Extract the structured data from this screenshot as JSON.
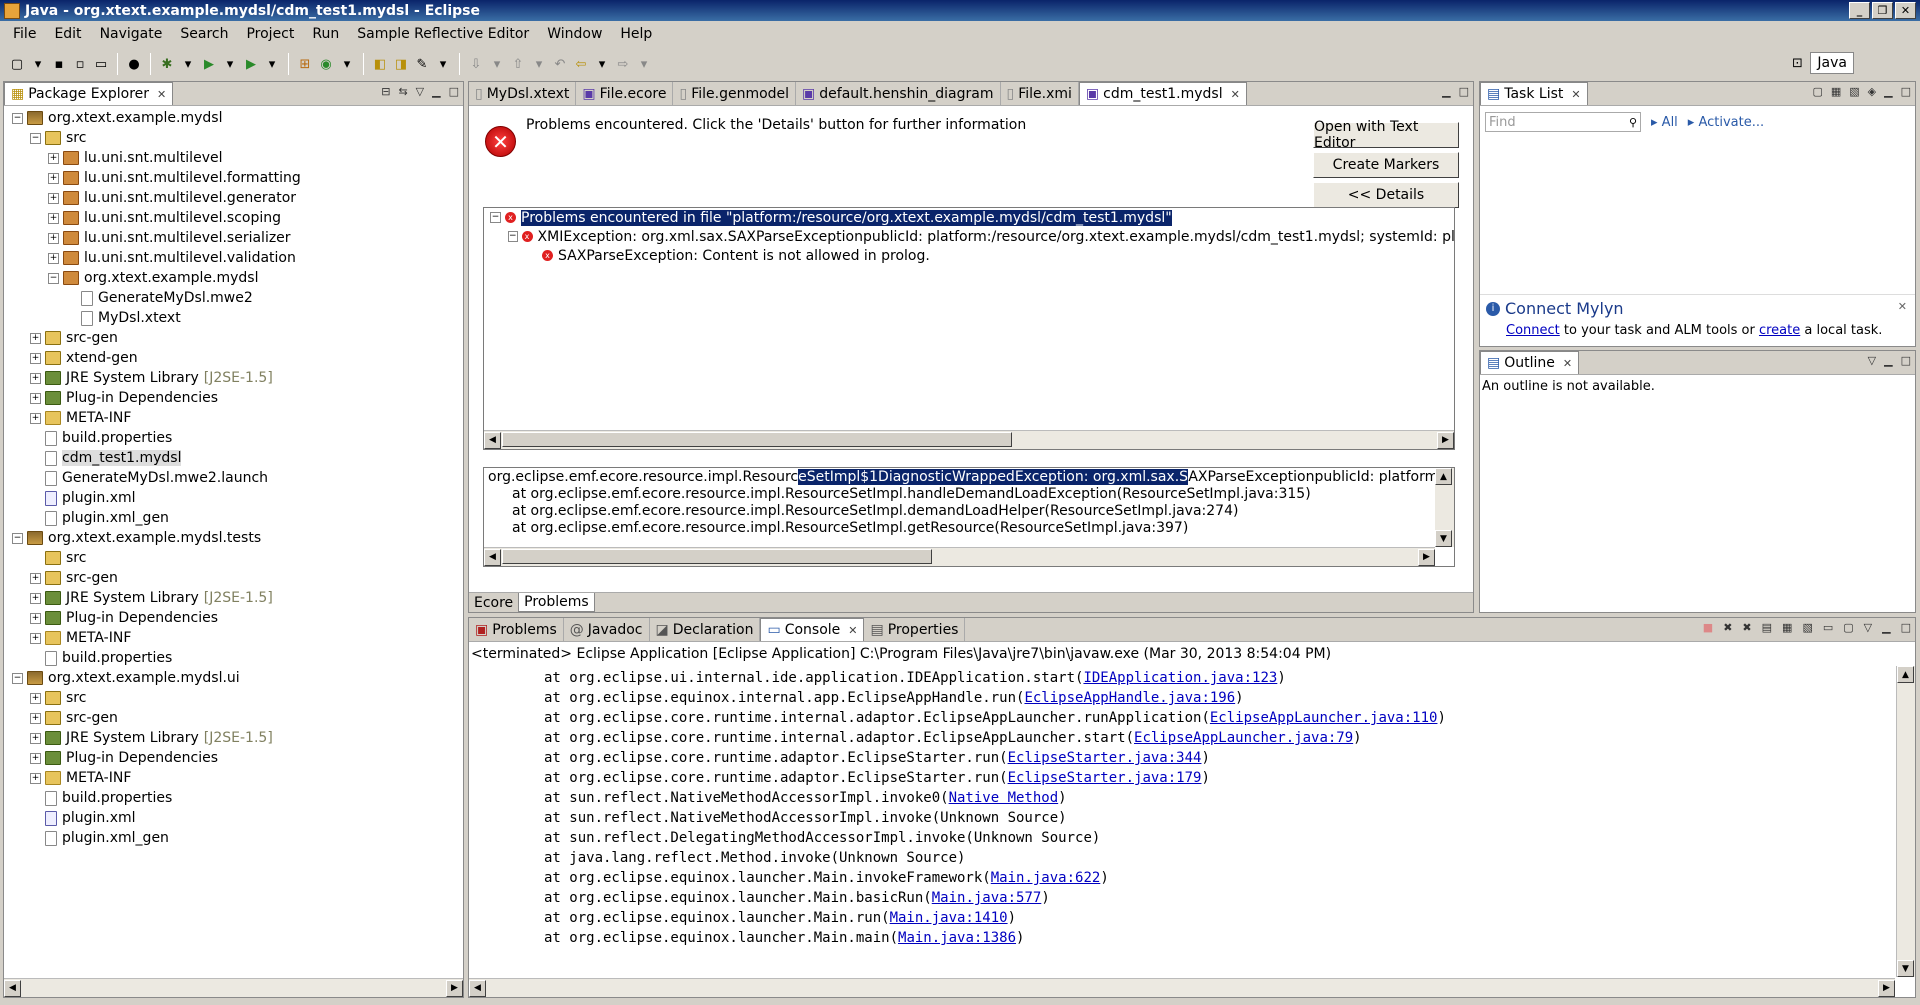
{
  "window": {
    "title": "Java - org.xtext.example.mydsl/cdm_test1.mydsl - Eclipse"
  },
  "menu": [
    "File",
    "Edit",
    "Navigate",
    "Search",
    "Project",
    "Run",
    "Sample Reflective Editor",
    "Window",
    "Help"
  ],
  "perspective": {
    "label": "Java"
  },
  "package_explorer": {
    "title": "Package Explorer",
    "rows": [
      {
        "indent": 0,
        "tw": "-",
        "icon": "prj",
        "label": "org.xtext.example.mydsl"
      },
      {
        "indent": 1,
        "tw": "-",
        "icon": "srcf",
        "label": "src"
      },
      {
        "indent": 2,
        "tw": "+",
        "icon": "pkg",
        "label": "lu.uni.snt.multilevel"
      },
      {
        "indent": 2,
        "tw": "+",
        "icon": "pkg",
        "label": "lu.uni.snt.multilevel.formatting"
      },
      {
        "indent": 2,
        "tw": "+",
        "icon": "pkg",
        "label": "lu.uni.snt.multilevel.generator"
      },
      {
        "indent": 2,
        "tw": "+",
        "icon": "pkg",
        "label": "lu.uni.snt.multilevel.scoping"
      },
      {
        "indent": 2,
        "tw": "+",
        "icon": "pkg",
        "label": "lu.uni.snt.multilevel.serializer"
      },
      {
        "indent": 2,
        "tw": "+",
        "icon": "pkg",
        "label": "lu.uni.snt.multilevel.validation"
      },
      {
        "indent": 2,
        "tw": "-",
        "icon": "pkg",
        "label": "org.xtext.example.mydsl"
      },
      {
        "indent": 3,
        "tw": "",
        "icon": "file",
        "label": "GenerateMyDsl.mwe2"
      },
      {
        "indent": 3,
        "tw": "",
        "icon": "file",
        "label": "MyDsl.xtext"
      },
      {
        "indent": 1,
        "tw": "+",
        "icon": "srcf",
        "label": "src-gen"
      },
      {
        "indent": 1,
        "tw": "+",
        "icon": "srcf",
        "label": "xtend-gen"
      },
      {
        "indent": 1,
        "tw": "+",
        "icon": "lib",
        "label": "JRE System Library",
        "extra": "[J2SE-1.5]"
      },
      {
        "indent": 1,
        "tw": "+",
        "icon": "lib",
        "label": "Plug-in Dependencies"
      },
      {
        "indent": 1,
        "tw": "+",
        "icon": "fold",
        "label": "META-INF"
      },
      {
        "indent": 1,
        "tw": "",
        "icon": "file",
        "label": "build.properties"
      },
      {
        "indent": 1,
        "tw": "",
        "icon": "file",
        "label": "cdm_test1.mydsl",
        "selected": true
      },
      {
        "indent": 1,
        "tw": "",
        "icon": "file",
        "label": "GenerateMyDsl.mwe2.launch"
      },
      {
        "indent": 1,
        "tw": "",
        "icon": "xml",
        "label": "plugin.xml"
      },
      {
        "indent": 1,
        "tw": "",
        "icon": "file",
        "label": "plugin.xml_gen"
      },
      {
        "indent": 0,
        "tw": "-",
        "icon": "prj",
        "label": "org.xtext.example.mydsl.tests"
      },
      {
        "indent": 1,
        "tw": "",
        "icon": "srcf",
        "label": "src"
      },
      {
        "indent": 1,
        "tw": "+",
        "icon": "srcf",
        "label": "src-gen"
      },
      {
        "indent": 1,
        "tw": "+",
        "icon": "lib",
        "label": "JRE System Library",
        "extra": "[J2SE-1.5]"
      },
      {
        "indent": 1,
        "tw": "+",
        "icon": "lib",
        "label": "Plug-in Dependencies"
      },
      {
        "indent": 1,
        "tw": "+",
        "icon": "fold",
        "label": "META-INF"
      },
      {
        "indent": 1,
        "tw": "",
        "icon": "file",
        "label": "build.properties"
      },
      {
        "indent": 0,
        "tw": "-",
        "icon": "prj",
        "label": "org.xtext.example.mydsl.ui"
      },
      {
        "indent": 1,
        "tw": "+",
        "icon": "srcf",
        "label": "src"
      },
      {
        "indent": 1,
        "tw": "+",
        "icon": "srcf",
        "label": "src-gen"
      },
      {
        "indent": 1,
        "tw": "+",
        "icon": "lib",
        "label": "JRE System Library",
        "extra": "[J2SE-1.5]"
      },
      {
        "indent": 1,
        "tw": "+",
        "icon": "lib",
        "label": "Plug-in Dependencies"
      },
      {
        "indent": 1,
        "tw": "+",
        "icon": "fold",
        "label": "META-INF"
      },
      {
        "indent": 1,
        "tw": "",
        "icon": "file",
        "label": "build.properties"
      },
      {
        "indent": 1,
        "tw": "",
        "icon": "xml",
        "label": "plugin.xml"
      },
      {
        "indent": 1,
        "tw": "",
        "icon": "file",
        "label": "plugin.xml_gen"
      }
    ]
  },
  "editor": {
    "tabs": [
      "MyDsl.xtext",
      "File.ecore",
      "File.genmodel",
      "default.henshin_diagram",
      "File.xmi",
      "cdm_test1.mydsl"
    ],
    "message": "Problems encountered.  Click the 'Details' button for further information",
    "buttons": {
      "open": "Open with Text Editor",
      "markers": "Create Markers",
      "details": "<< Details"
    },
    "problems": [
      {
        "level": 0,
        "text": "Problems encountered in file \"platform:/resource/org.xtext.example.mydsl/cdm_test1.mydsl\""
      },
      {
        "level": 1,
        "text": "XMIException: org.xml.sax.SAXParseExceptionpublicId: platform:/resource/org.xtext.example.mydsl/cdm_test1.mydsl; systemId: platform:/resource"
      },
      {
        "level": 2,
        "text": "SAXParseException: Content is not allowed in prolog."
      }
    ],
    "trace": {
      "first_pre": "org.eclipse.emf.ecore.resource.impl.Resourc",
      "first_sel": "eSetImpl$1DiagnosticWrappedException: org.xml.sax.S",
      "first_post": "AXParseExceptionpublicId: platform:/resource/org.xte",
      "lines": [
        "at org.eclipse.emf.ecore.resource.impl.ResourceSetImpl.handleDemandLoadException(ResourceSetImpl.java:315)",
        "at org.eclipse.emf.ecore.resource.impl.ResourceSetImpl.demandLoadHelper(ResourceSetImpl.java:274)",
        "at org.eclipse.emf.ecore.resource.impl.ResourceSetImpl.getResource(ResourceSetImpl.java:397)"
      ]
    },
    "bottom_tabs": [
      "Ecore",
      "Problems"
    ]
  },
  "tasklist": {
    "title": "Task List",
    "find_placeholder": "Find",
    "all": "All",
    "activate": "Activate...",
    "mylyn_title": "Connect Mylyn",
    "mylyn_connect": "Connect",
    "mylyn_mid": " to your task and ALM tools or ",
    "mylyn_create": "create",
    "mylyn_end": " a local task."
  },
  "outline": {
    "title": "Outline",
    "message": "An outline is not available."
  },
  "bottom": {
    "tabs": [
      "Problems",
      "Javadoc",
      "Declaration",
      "Console",
      "Properties"
    ],
    "status": "<terminated> Eclipse Application [Eclipse Application] C:\\Program Files\\Java\\jre7\\bin\\javaw.exe (Mar 30, 2013 8:54:04 PM)",
    "lines": [
      {
        "pre": "at org.eclipse.ui.internal.ide.application.IDEApplication.start(",
        "link": "IDEApplication.java:123",
        "post": ")"
      },
      {
        "pre": "at org.eclipse.equinox.internal.app.EclipseAppHandle.run(",
        "link": "EclipseAppHandle.java:196",
        "post": ")"
      },
      {
        "pre": "at org.eclipse.core.runtime.internal.adaptor.EclipseAppLauncher.runApplication(",
        "link": "EclipseAppLauncher.java:110",
        "post": ")"
      },
      {
        "pre": "at org.eclipse.core.runtime.internal.adaptor.EclipseAppLauncher.start(",
        "link": "EclipseAppLauncher.java:79",
        "post": ")"
      },
      {
        "pre": "at org.eclipse.core.runtime.adaptor.EclipseStarter.run(",
        "link": "EclipseStarter.java:344",
        "post": ")"
      },
      {
        "pre": "at org.eclipse.core.runtime.adaptor.EclipseStarter.run(",
        "link": "EclipseStarter.java:179",
        "post": ")"
      },
      {
        "pre": "at sun.reflect.NativeMethodAccessorImpl.invoke0(",
        "link": "Native Method",
        "post": ")"
      },
      {
        "pre": "at sun.reflect.NativeMethodAccessorImpl.invoke(Unknown Source)",
        "link": "",
        "post": ""
      },
      {
        "pre": "at sun.reflect.DelegatingMethodAccessorImpl.invoke(Unknown Source)",
        "link": "",
        "post": ""
      },
      {
        "pre": "at java.lang.reflect.Method.invoke(Unknown Source)",
        "link": "",
        "post": ""
      },
      {
        "pre": "at org.eclipse.equinox.launcher.Main.invokeFramework(",
        "link": "Main.java:622",
        "post": ")"
      },
      {
        "pre": "at org.eclipse.equinox.launcher.Main.basicRun(",
        "link": "Main.java:577",
        "post": ")"
      },
      {
        "pre": "at org.eclipse.equinox.launcher.Main.run(",
        "link": "Main.java:1410",
        "post": ")"
      },
      {
        "pre": "at org.eclipse.equinox.launcher.Main.main(",
        "link": "Main.java:1386",
        "post": ")"
      }
    ]
  }
}
